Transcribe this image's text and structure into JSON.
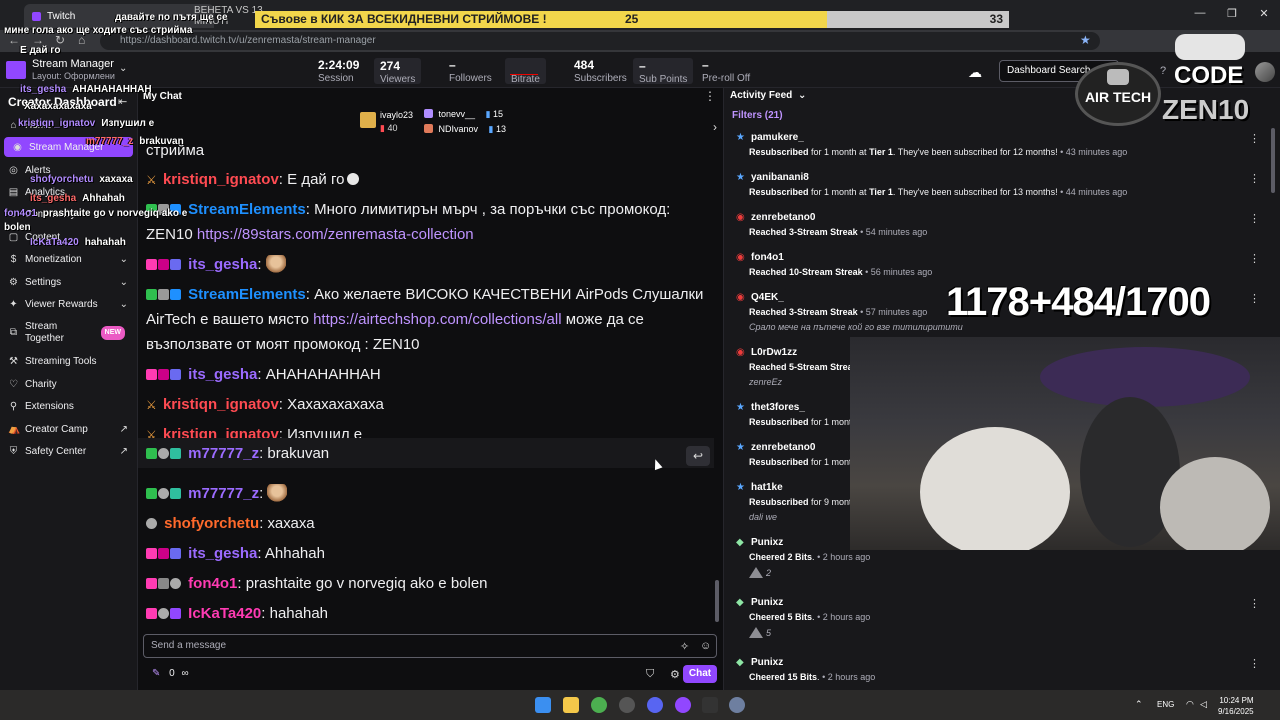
{
  "browser": {
    "tab_title": "Twitch",
    "tab2_title": "BEHETA VS 13 MINUTI",
    "url": "https://dashboard.twitch.tv/u/zenremasta/stream-manager",
    "window_controls": [
      "—",
      "❐",
      "✕"
    ]
  },
  "goal": {
    "text": "Съвове в КИК ЗА ВСЕКИДНЕВНИ СТРИЙМОВЕ !",
    "current": "25",
    "target": "33",
    "progress_fraction": 0.758
  },
  "topbar": {
    "title": "Stream Manager",
    "layout": "Layout: Оформлени",
    "stats": [
      {
        "value": "2:24:09",
        "label": "Session"
      },
      {
        "value": "274",
        "label": "Viewers"
      },
      {
        "value": "–",
        "label": "Followers"
      },
      {
        "value": "",
        "label": "Bitrate"
      },
      {
        "value": "484",
        "label": "Subscribers"
      },
      {
        "value": "–",
        "label": "Sub Points"
      },
      {
        "value": "–",
        "label": "Pre-roll Off"
      }
    ],
    "search_placeholder": "Dashboard Search"
  },
  "sidebar": {
    "title": "Creator Dashboard",
    "items": [
      {
        "label": "Home",
        "icon": "home-icon"
      },
      {
        "label": "Stream Manager",
        "icon": "stream-icon",
        "active": true
      },
      {
        "label": "Alerts",
        "icon": "alert-icon"
      },
      {
        "label": "Analytics",
        "icon": "chart-icon"
      },
      {
        "label": "Community",
        "icon": "community-icon"
      },
      {
        "label": "Content",
        "icon": "content-icon"
      },
      {
        "label": "Monetization",
        "icon": "money-icon"
      },
      {
        "label": "Settings",
        "icon": "settings-icon"
      },
      {
        "label": "Viewer Rewards",
        "icon": "reward-icon"
      },
      {
        "label": "Stream Together",
        "icon": "together-icon",
        "badge": "NEW"
      },
      {
        "label": "Streaming Tools",
        "icon": "tools-icon"
      },
      {
        "label": "Charity",
        "icon": "charity-icon"
      },
      {
        "label": "Extensions",
        "icon": "extensions-icon"
      },
      {
        "label": "Creator Camp",
        "icon": "camp-icon"
      },
      {
        "label": "Safety Center",
        "icon": "safety-icon"
      }
    ]
  },
  "overlay_chat": [
    {
      "user": "",
      "text": "давайте по пътя ще се"
    },
    {
      "user": "",
      "text": "мине гола ако ще ходите със стрийма"
    },
    {
      "user": "",
      "text": "Е дай го"
    },
    {
      "user": "its_gesha",
      "text": "АНАНАНАННАН"
    },
    {
      "user": "",
      "text": "Хахахахахаха"
    },
    {
      "user": "kristiqn_ignatov",
      "text": "Изпушил е"
    },
    {
      "user": "m77777_z",
      "text": "brakuvan"
    },
    {
      "user": "shofyorchetu",
      "text": "хахаха"
    },
    {
      "user": "its_gesha",
      "text": "Ahhahah"
    },
    {
      "user": "fon4o1",
      "text": "prashtaite go v norvegiq ako e"
    },
    {
      "user": "",
      "text": "bolen"
    },
    {
      "user": "IcKaTa420",
      "text": "hahahah"
    }
  ],
  "chat": {
    "header": "My Chat",
    "leaderboard": [
      {
        "name": "ivaylo23",
        "value": "40"
      },
      {
        "name": "tonevv__",
        "value": "15"
      },
      {
        "name": "NDIvanov",
        "value": "13"
      }
    ],
    "messages": [
      {
        "user": "",
        "text": "стрийма",
        "color": "#efeff1"
      },
      {
        "user": "kristiqn_ignatov",
        "text": "Е дай го",
        "color": "#ff4b52"
      },
      {
        "user": "StreamElements",
        "text": "Много лимитирън мърч , за поръчки със промокод: ZEN10 ",
        "link": "https://89stars.com/zenremasta-collection",
        "color": "#1e90ff"
      },
      {
        "user": "its_gesha",
        "text": "",
        "color": "#9b6bff"
      },
      {
        "user": "StreamElements",
        "text": "Ако желаете ВИСОКО КАЧЕСТВЕНИ AirPods Слушалки AirTech е вашето място ",
        "link": "https://airtechshop.com/collections/all",
        "text2": " може да се възползвате от моят промокод : ZEN10",
        "color": "#1e90ff"
      },
      {
        "user": "its_gesha",
        "text": "АНАНАНАННАН",
        "color": "#9b6bff"
      },
      {
        "user": "kristiqn_ignatov",
        "text": "Хахахахахаха",
        "color": "#ff4b52"
      },
      {
        "user": "kristiqn_ignatov",
        "text": "Изпушил е",
        "color": "#ff4b52"
      },
      {
        "user": "m77777_z",
        "text": "brakuvan",
        "color": "#9b6bff"
      },
      {
        "user": "m77777_z",
        "text": "",
        "color": "#9b6bff"
      },
      {
        "user": "shofyorchetu",
        "text": "хахаха",
        "color": "#ff6a2c"
      },
      {
        "user": "its_gesha",
        "text": "Ahhahah",
        "color": "#9b6bff"
      },
      {
        "user": "fon4o1",
        "text": "prashtaite go v norvegiq ako e bolen",
        "color": "#ff3bb3"
      },
      {
        "user": "IcKaTa420",
        "text": "hahahah",
        "color": "#ff3bb3"
      }
    ],
    "input_placeholder": "Send a message",
    "points": "0",
    "points_suffix": "∞",
    "send_label": "Chat"
  },
  "feed": {
    "title": "Activity Feed",
    "filters": "Filters (21)",
    "items": [
      {
        "name": "pamukere_",
        "pre": "Resubscribed",
        "mid": " for 1 month at ",
        "tier": "Tier 1",
        "post": ". They've been subscribed for 12 months!",
        "time": " • 43 minutes ago",
        "icon": "star-icon",
        "msg": ""
      },
      {
        "name": "yanibanani8",
        "pre": "Resubscribed",
        "mid": " for 1 month at ",
        "tier": "Tier 1",
        "post": ". They've been subscribed for 13 months!",
        "time": " • 44 minutes ago",
        "icon": "star-icon",
        "msg": ""
      },
      {
        "name": "zenrebetano0",
        "pre": "Reached",
        "mid": " ",
        "tier": "3-Stream Streak",
        "post": "",
        "time": " • 54 minutes ago",
        "icon": "streak-icon",
        "msg": ""
      },
      {
        "name": "fon4o1",
        "pre": "Reached",
        "mid": " ",
        "tier": "10-Stream Streak",
        "post": "",
        "time": " • 56 minutes ago",
        "icon": "streak-icon",
        "msg": ""
      },
      {
        "name": "Q4EK_",
        "pre": "Reached",
        "mid": " ",
        "tier": "3-Stream Streak",
        "post": "",
        "time": " • 57 minutes ago",
        "icon": "streak-icon",
        "msg": "Срало мече на пътече кой го взе титилиритити"
      },
      {
        "name": "L0rDw1zz",
        "pre": "Reached",
        "mid": " ",
        "tier": "5-Stream Streak",
        "post": "",
        "time": "",
        "icon": "streak-icon",
        "msg": "zenreEz"
      },
      {
        "name": "thet3fores_",
        "pre": "Resubscribed",
        "mid": " for 1 month",
        "tier": "",
        "post": "",
        "time": "",
        "icon": "star-icon",
        "msg": ""
      },
      {
        "name": "zenrebetano0",
        "pre": "Resubscribed",
        "mid": " for 1 month",
        "tier": "",
        "post": "",
        "time": "",
        "icon": "star-icon",
        "msg": ""
      },
      {
        "name": "hat1ke",
        "pre": "Resubscribed",
        "mid": " for 9 months",
        "tier": "",
        "post": "",
        "time": "",
        "icon": "star-icon",
        "msg": "dali we"
      },
      {
        "name": "Punixz",
        "pre": "Cheered",
        "mid": " ",
        "tier": "2 Bits",
        "post": ".",
        "time": " • 2 hours ago",
        "icon": "bits-icon",
        "msg": "2"
      },
      {
        "name": "Punixz",
        "pre": "Cheered",
        "mid": " ",
        "tier": "5 Bits",
        "post": ".",
        "time": " • 2 hours ago",
        "icon": "bits-icon",
        "msg": "5"
      },
      {
        "name": "Punixz",
        "pre": "Cheered",
        "mid": " ",
        "tier": "15 Bits",
        "post": ".",
        "time": " • 2 hours ago",
        "icon": "bits-icon",
        "msg": ""
      }
    ]
  },
  "overlay": {
    "counter": "1178+484/1700",
    "brand": "AIR TECH",
    "code_label": "CODE",
    "code_value": "ZEN10"
  },
  "taskbar": {
    "lang": "ENG",
    "time": "10:24 PM",
    "date": "9/16/2025"
  },
  "colors": {
    "accent": "#9147ff",
    "live_red": "#eb0400",
    "goal_fill": "#f2d64b"
  }
}
